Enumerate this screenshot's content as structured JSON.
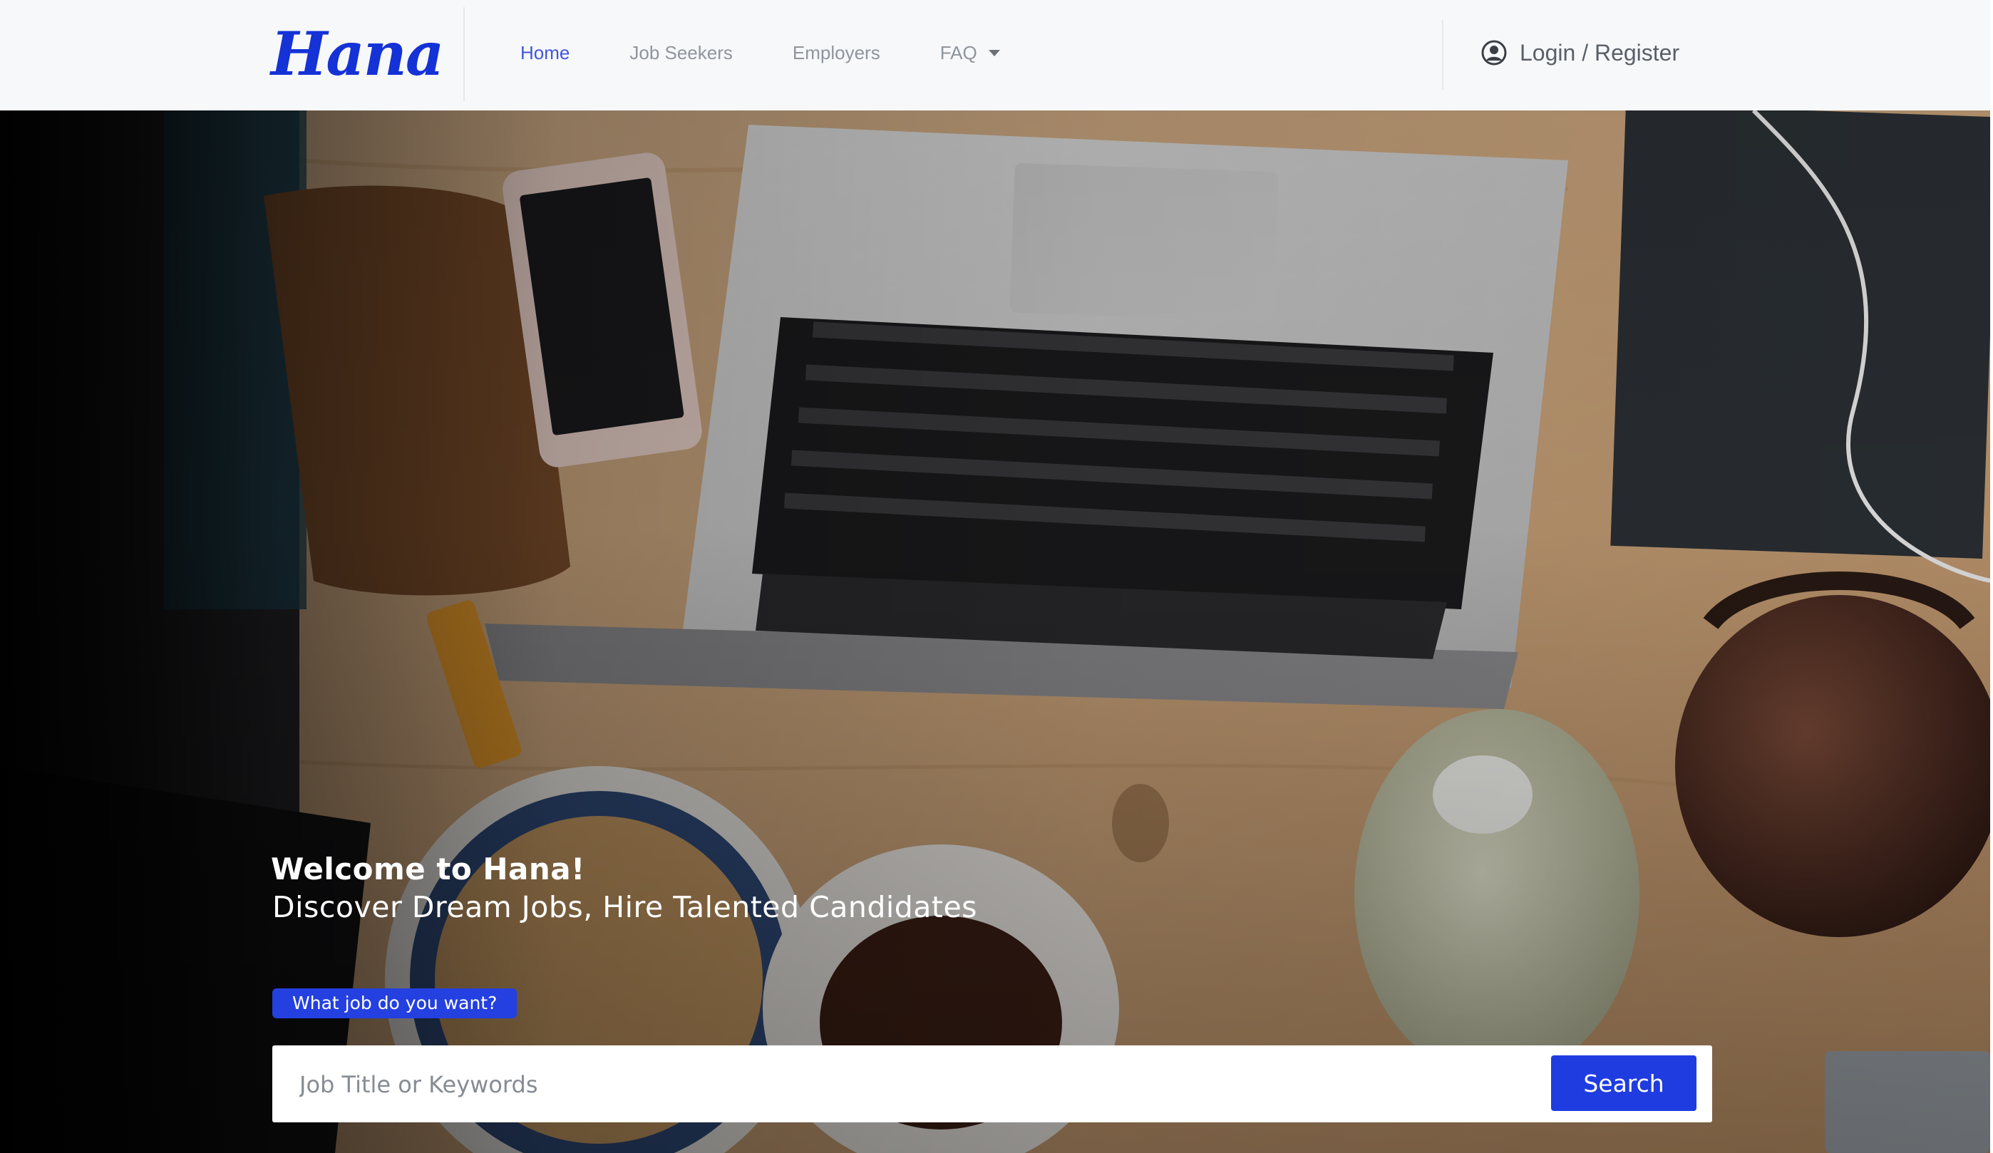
{
  "brand": {
    "logo_text": "Hana",
    "accent_color": "#1432d6"
  },
  "nav": {
    "links": [
      {
        "label": "Home",
        "active": true
      },
      {
        "label": "Job Seekers",
        "active": false
      },
      {
        "label": "Employers",
        "active": false
      },
      {
        "label": "FAQ",
        "active": false,
        "dropdown": true
      }
    ],
    "login_label": "Login / Register",
    "login_icon": "user-circle-icon"
  },
  "hero": {
    "title": "Welcome to Hana!",
    "subtitle": "Discover Dream Jobs, Hire Talented Candidates",
    "badge": "What job do you want?",
    "search": {
      "placeholder": "Job Title or Keywords",
      "value": "",
      "button_label": "Search"
    },
    "background": "desk-workspace-photo"
  },
  "colors": {
    "primary_button": "#1f3ce0",
    "active_link": "#4255dc",
    "muted_link": "#8f959c"
  }
}
